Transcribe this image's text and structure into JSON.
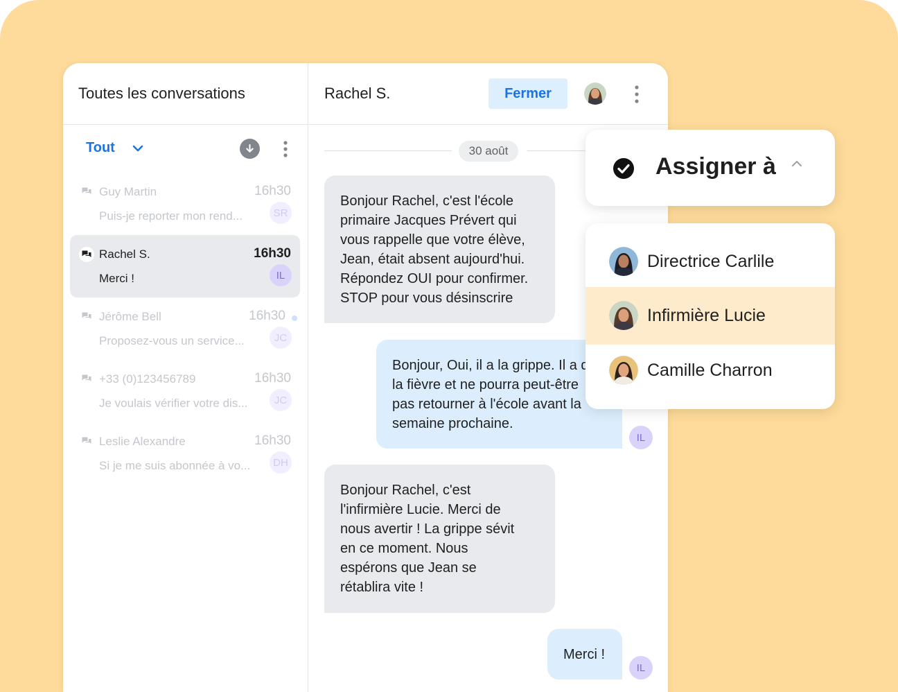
{
  "sidebar": {
    "title": "Toutes les conversations",
    "filter": "Tout",
    "conversations": [
      {
        "name": "Guy Martin",
        "time": "16h30",
        "preview": "Puis-je reporter mon rend...",
        "initials": "SR",
        "active": false,
        "unread": false
      },
      {
        "name": "Rachel S.",
        "time": "16h30",
        "preview": "Merci !",
        "initials": "IL",
        "active": true,
        "unread": false
      },
      {
        "name": "Jérôme Bell",
        "time": "16h30",
        "preview": "Proposez-vous un service...",
        "initials": "JC",
        "active": false,
        "unread": true
      },
      {
        "name": "+33 (0)123456789",
        "time": "16h30",
        "preview": "Je voulais vérifier votre dis...",
        "initials": "JC",
        "active": false,
        "unread": false
      },
      {
        "name": "Leslie Alexandre",
        "time": "16h30",
        "preview": "Si je me suis abonnée à vo...",
        "initials": "DH",
        "active": false,
        "unread": false
      }
    ]
  },
  "chat": {
    "contact_name": "Rachel S.",
    "close_label": "Fermer",
    "date_separator": "30 août",
    "messages": [
      {
        "direction": "in",
        "lines": [
          "Bonjour Rachel, c'est l'école",
          "primaire Jacques Prévert qui",
          "vous rappelle que votre élève,",
          "Jean, était absent aujourd'hui.",
          "Répondez OUI pour confirmer.",
          "STOP pour vous désinscrire"
        ]
      },
      {
        "direction": "out",
        "lines": [
          "Bonjour, Oui, il a la grippe. Il a d",
          "la fièvre et ne pourra peut-être",
          "pas retourner à l'école avant la",
          "semaine prochaine."
        ],
        "initials": "IL"
      },
      {
        "direction": "in",
        "lines": [
          "Bonjour Rachel, c'est",
          "l'infirmière Lucie. Merci de",
          "nous avertir ! La grippe sévit",
          "en ce moment. Nous",
          "espérons que Jean se",
          "rétablira vite !"
        ]
      },
      {
        "direction": "out",
        "lines": [
          "Merci !"
        ],
        "initials": "IL"
      }
    ]
  },
  "assign": {
    "title": "Assigner à",
    "agents": [
      {
        "name": "Directrice Carlile",
        "highlighted": false
      },
      {
        "name": "Infirmière Lucie",
        "highlighted": true
      },
      {
        "name": "Camille Charron",
        "highlighted": false
      }
    ]
  },
  "colors": {
    "backdrop": "#fedb9a",
    "accent": "#1a73e8",
    "highlight": "#fdebcc"
  }
}
